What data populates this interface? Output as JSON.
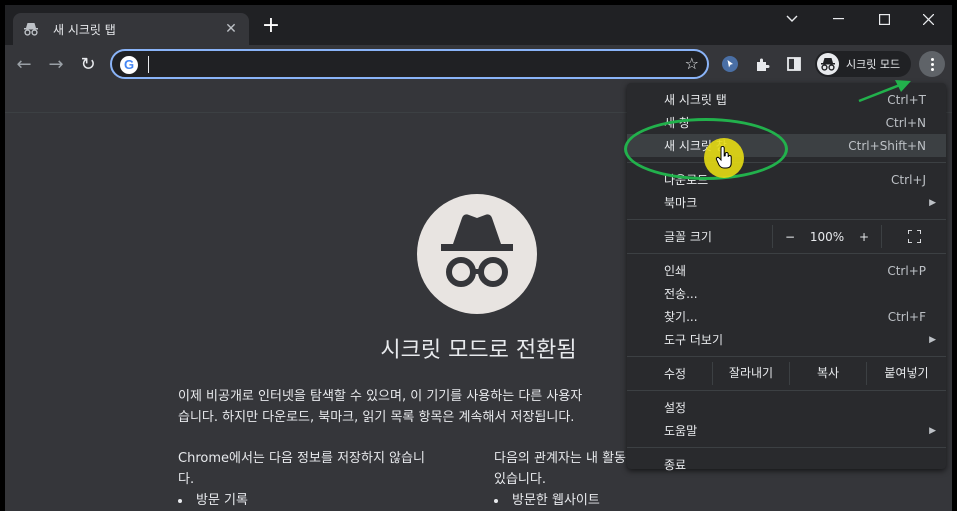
{
  "tab": {
    "title": "새 시크릿 탭",
    "close": "✕"
  },
  "window": {
    "minimize": "—",
    "maximize": "☐",
    "close": "✕",
    "chevron": "⌄"
  },
  "toolbar": {
    "back": "←",
    "forward": "→",
    "reload": "↻",
    "profile_label": "시크릿 모드"
  },
  "content": {
    "title": "시크릿 모드로 전환됨",
    "para_line1": "이제 비공개로 인터넷을 탐색할 수 있으며, 이 기기를 사용하는 다른 사용자",
    "para_line2": "습니다. 하지만 다운로드, 북마크, 읽기 목록 항목은 계속해서 저장됩니다.",
    "col1_heading": "Chrome에서는 다음 정보를 저장하지 않습니",
    "col1_heading2": "다.",
    "col1_bullet": "방문 기록",
    "col2_heading": "다음의 관계자는 내 활동",
    "col2_heading2": "있습니다.",
    "col2_bullet": "방문한 웹사이트"
  },
  "menu": {
    "items": [
      {
        "label": "새 시크릿 탭",
        "shortcut": "Ctrl+T"
      },
      {
        "label": "새 창",
        "shortcut": "Ctrl+N"
      },
      {
        "label": "새 시크릿 창",
        "shortcut": "Ctrl+Shift+N"
      },
      {
        "label": "다운로드",
        "shortcut": "Ctrl+J"
      },
      {
        "label": "북마크",
        "shortcut": ""
      }
    ],
    "zoom": {
      "label": "글꼴 크기",
      "minus": "−",
      "value": "100%",
      "plus": "+"
    },
    "items2": [
      {
        "label": "인쇄",
        "shortcut": "Ctrl+P"
      },
      {
        "label": "전송...",
        "shortcut": ""
      },
      {
        "label": "찾기...",
        "shortcut": "Ctrl+F"
      },
      {
        "label": "도구 더보기",
        "shortcut": ""
      }
    ],
    "edit": {
      "label": "수정",
      "cut": "잘라내기",
      "copy": "복사",
      "paste": "붙여넣기"
    },
    "items3": [
      {
        "label": "설정"
      },
      {
        "label": "도움말"
      }
    ],
    "exit": "종료"
  }
}
